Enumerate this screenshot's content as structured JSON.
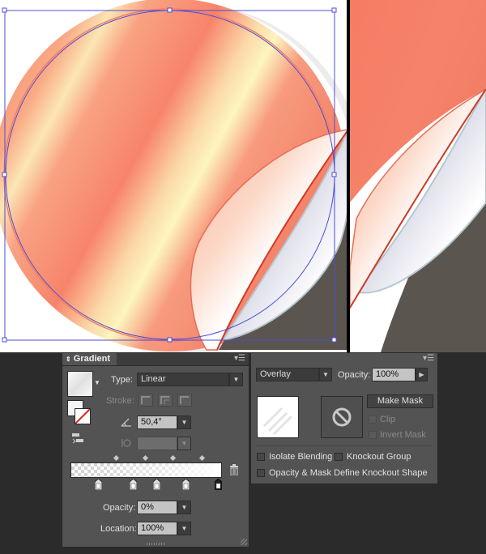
{
  "canvas": {
    "sticker_fill": "#f38468",
    "rim_color": "#ffffff",
    "shadow_color": "#5b554f",
    "selection_color": "#4c4cd6"
  },
  "gradient_panel": {
    "tab_label": "Gradient",
    "type_label": "Type:",
    "type_value": "Linear",
    "stroke_label": "Stroke:",
    "angle_value": "50,4°",
    "aspect_value": "",
    "opacity_label": "Opacity:",
    "opacity_value": "0%",
    "location_label": "Location:",
    "location_value": "100%"
  },
  "transparency_panel": {
    "blend_mode": "Overlay",
    "opacity_label": "Opacity:",
    "opacity_value": "100%",
    "make_mask_label": "Make Mask",
    "clip_label": "Clip",
    "invert_mask_label": "Invert Mask",
    "isolate_blending_label": "Isolate Blending",
    "knockout_group_label": "Knockout Group",
    "opacity_mask_label": "Opacity & Mask Define Knockout Shape"
  }
}
